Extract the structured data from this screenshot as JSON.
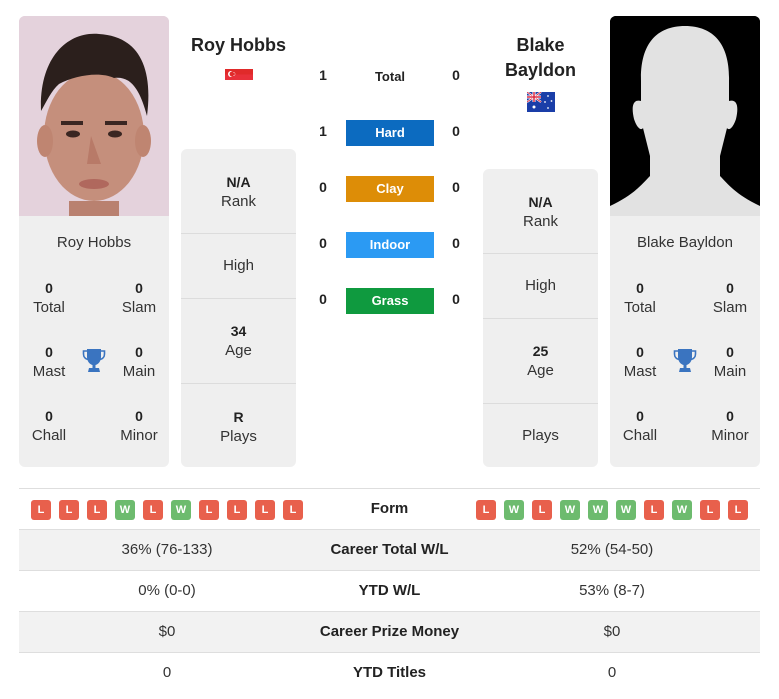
{
  "colors": {
    "hard": "#0c6bc0",
    "clay": "#dd8d07",
    "indoor": "#2b9af3",
    "grass": "#0f9a3f",
    "loss": "#e8604c",
    "win": "#6dbb6e",
    "trophy": "#3a74c0"
  },
  "player1": {
    "name": "Roy Hobbs",
    "flag": "singapore-flag",
    "card_name": "Roy Hobbs",
    "titles": {
      "total": {
        "value": "0",
        "label": "Total"
      },
      "slam": {
        "value": "0",
        "label": "Slam"
      },
      "mast": {
        "value": "0",
        "label": "Mast"
      },
      "main": {
        "value": "0",
        "label": "Main"
      },
      "chall": {
        "value": "0",
        "label": "Chall"
      },
      "minor": {
        "value": "0",
        "label": "Minor"
      }
    },
    "stats": {
      "rank": {
        "value": "N/A",
        "label": "Rank"
      },
      "high": {
        "value": "",
        "label": "High"
      },
      "age": {
        "value": "34",
        "label": "Age"
      },
      "plays": {
        "value": "R",
        "label": "Plays"
      }
    }
  },
  "player2": {
    "name": "Blake Bayldon",
    "name_line1": "Blake",
    "name_line2": "Bayldon",
    "flag": "australia-flag",
    "card_name": "Blake Bayldon",
    "titles": {
      "total": {
        "value": "0",
        "label": "Total"
      },
      "slam": {
        "value": "0",
        "label": "Slam"
      },
      "mast": {
        "value": "0",
        "label": "Mast"
      },
      "main": {
        "value": "0",
        "label": "Main"
      },
      "chall": {
        "value": "0",
        "label": "Chall"
      },
      "minor": {
        "value": "0",
        "label": "Minor"
      }
    },
    "stats": {
      "rank": {
        "value": "N/A",
        "label": "Rank"
      },
      "high": {
        "value": "",
        "label": "High"
      },
      "age": {
        "value": "25",
        "label": "Age"
      },
      "plays": {
        "value": "",
        "label": "Plays"
      }
    }
  },
  "h2h": [
    {
      "surface": "Total",
      "p1": "1",
      "p2": "0"
    },
    {
      "surface": "Hard",
      "p1": "1",
      "p2": "0"
    },
    {
      "surface": "Clay",
      "p1": "0",
      "p2": "0"
    },
    {
      "surface": "Indoor",
      "p1": "0",
      "p2": "0"
    },
    {
      "surface": "Grass",
      "p1": "0",
      "p2": "0"
    }
  ],
  "comparison": {
    "form_label": "Form",
    "p1_form": [
      "L",
      "L",
      "L",
      "W",
      "L",
      "W",
      "L",
      "L",
      "L",
      "L"
    ],
    "p2_form": [
      "L",
      "W",
      "L",
      "W",
      "W",
      "W",
      "L",
      "W",
      "L",
      "L"
    ],
    "rows": [
      {
        "label": "Career Total W/L",
        "p1": "36% (76-133)",
        "p2": "52% (54-50)"
      },
      {
        "label": "YTD W/L",
        "p1": "0% (0-0)",
        "p2": "53% (8-7)"
      },
      {
        "label": "Career Prize Money",
        "p1": "$0",
        "p2": "$0"
      },
      {
        "label": "YTD Titles",
        "p1": "0",
        "p2": "0"
      }
    ]
  }
}
